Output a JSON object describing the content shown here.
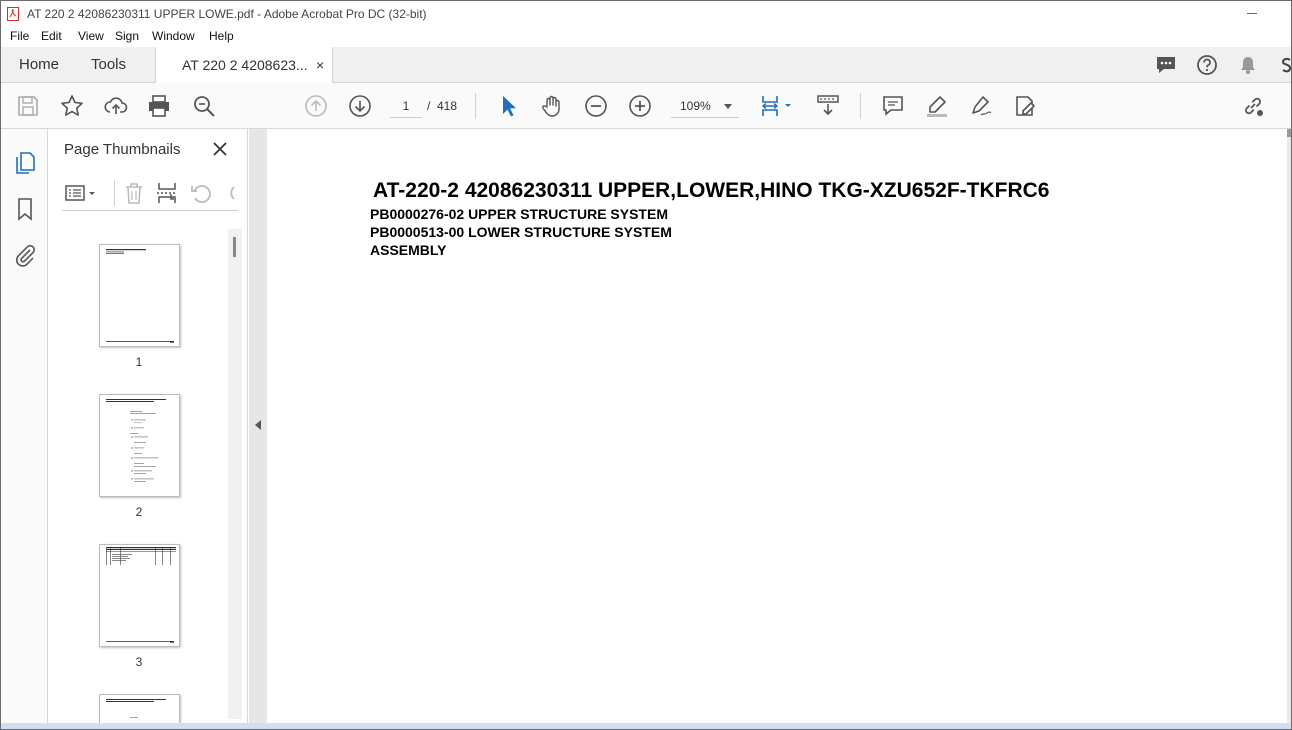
{
  "window": {
    "title": "AT 220 2 42086230311 UPPER LOWE.pdf - Adobe Acrobat Pro DC (32-bit)"
  },
  "menu": {
    "items": [
      "File",
      "Edit",
      "View",
      "Sign",
      "Window",
      "Help"
    ]
  },
  "tabs": {
    "home": "Home",
    "tools": "Tools",
    "document": "AT 220 2 4208623...",
    "close_symbol": "×"
  },
  "toolbar": {
    "page_current": "1",
    "page_sep": "/",
    "page_total": "418",
    "zoom": "109%"
  },
  "thumbnails": {
    "panel_title": "Page Thumbnails",
    "pages": [
      {
        "label": "1"
      },
      {
        "label": "2"
      },
      {
        "label": "3"
      }
    ]
  },
  "document": {
    "title": "AT-220-2 42086230311 UPPER,LOWER,HINO TKG-XZU652F-TKFRC6",
    "lines": [
      "PB0000276-02 UPPER STRUCTURE SYSTEM",
      "PB0000513-00 LOWER STRUCTURE SYSTEM",
      "ASSEMBLY"
    ]
  },
  "colors": {
    "accent_blue": "#1f6ebf",
    "pdf_red": "#d32f2f",
    "icon_gray": "#555555"
  }
}
